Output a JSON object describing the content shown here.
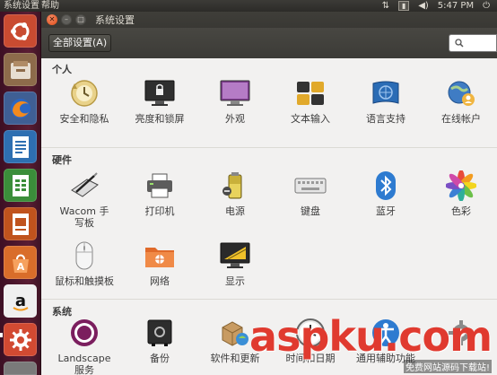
{
  "top_panel": {
    "menus": [
      "系统设置",
      "帮助"
    ],
    "time": "5:47 PM",
    "icons": [
      "keyboard-transfer-icon",
      "input-method-icon",
      "volume-icon",
      "power-icon"
    ]
  },
  "launcher": {
    "apps": [
      "ubuntu-dash-icon",
      "files-icon",
      "firefox-icon",
      "libreoffice-writer-icon",
      "libreoffice-calc-icon",
      "libreoffice-impress-icon",
      "software-center-icon",
      "amazon-icon",
      "system-settings-icon",
      "unknown-app-icon"
    ]
  },
  "window": {
    "title": "系统设置"
  },
  "toolbar": {
    "all_settings": "全部设置(A)"
  },
  "sections": {
    "personal": {
      "title": "个人",
      "items": [
        "安全和隐私",
        "亮度和锁屏",
        "外观",
        "文本输入",
        "语言支持",
        "在线帐户"
      ]
    },
    "hardware": {
      "title": "硬件",
      "items": [
        "Wacom 手写板",
        "打印机",
        "电源",
        "键盘",
        "蓝牙",
        "色彩",
        "鼠标和触摸板",
        "网络",
        "显示"
      ]
    },
    "system": {
      "title": "系统",
      "items": [
        "Landscape 服务",
        "备份",
        "软件和更新",
        "时间和日期",
        "通用辅助功能",
        ""
      ]
    }
  },
  "watermark": {
    "logo": "aspku.com",
    "sub": "免费网站源码下载站!"
  },
  "colors": {
    "launcher": "#5a1d33",
    "titlebar": "#3c3b37",
    "close": "#df4a16",
    "window_bg": "#f2f1f0"
  }
}
